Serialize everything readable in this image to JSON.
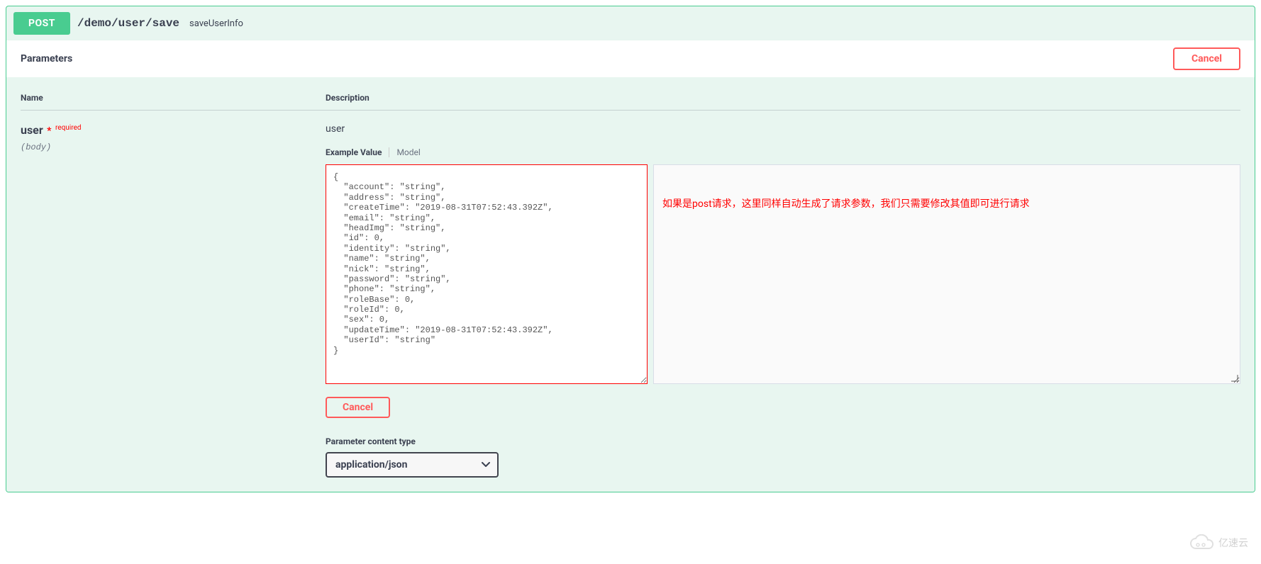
{
  "operation": {
    "method": "POST",
    "path": "/demo/user/save",
    "summary": "saveUserInfo"
  },
  "parametersSection": {
    "title": "Parameters",
    "cancelLabel": "Cancel"
  },
  "tableHeaders": {
    "name": "Name",
    "description": "Description"
  },
  "param": {
    "name": "user",
    "requiredMark": "*",
    "requiredLabel": "required",
    "location": "(body)",
    "description": "user"
  },
  "bodyTabs": {
    "exampleValue": "Example Value",
    "model": "Model"
  },
  "bodyJson": "{\n  \"account\": \"string\",\n  \"address\": \"string\",\n  \"createTime\": \"2019-08-31T07:52:43.392Z\",\n  \"email\": \"string\",\n  \"headImg\": \"string\",\n  \"id\": 0,\n  \"identity\": \"string\",\n  \"name\": \"string\",\n  \"nick\": \"string\",\n  \"password\": \"string\",\n  \"phone\": \"string\",\n  \"roleBase\": 0,\n  \"roleId\": 0,\n  \"sex\": 0,\n  \"updateTime\": \"2019-08-31T07:52:43.392Z\",\n  \"userId\": \"string\"\n}",
  "annotation": "如果是post请求，这里同样自动生成了请求参数，我们只需要修改其值即可进行请求",
  "bodyControls": {
    "cancelLabel": "Cancel"
  },
  "contentType": {
    "label": "Parameter content type",
    "selected": "application/json"
  },
  "watermark": "亿速云"
}
